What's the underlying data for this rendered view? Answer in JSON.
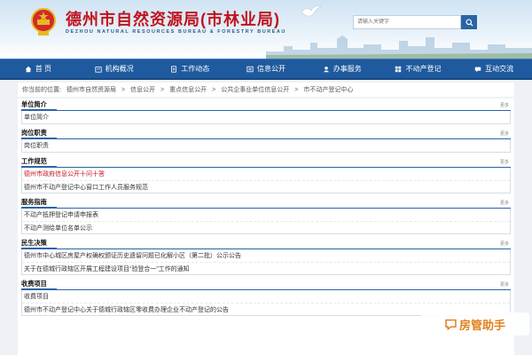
{
  "header": {
    "title": "德州市自然资源局(市林业局)",
    "subtitle": "DEZHOU NATURAL RESOURCES BUREAU & FORESTRY BUREAU",
    "search_placeholder": "请输入关键字"
  },
  "nav": [
    {
      "label": "首 页",
      "icon": "home-icon"
    },
    {
      "label": "机构概况",
      "icon": "building-icon"
    },
    {
      "label": "工作动态",
      "icon": "document-icon"
    },
    {
      "label": "信息公开",
      "icon": "info-icon"
    },
    {
      "label": "办事服务",
      "icon": "service-icon"
    },
    {
      "label": "不动产登记",
      "icon": "grid-icon"
    },
    {
      "label": "互动交流",
      "icon": "chat-icon"
    }
  ],
  "breadcrumb": {
    "prefix": "你当前的位置:",
    "items": [
      "德州市自然资源局",
      "信息公开",
      "重点信息公开",
      "公共企事业单位信息公开",
      "市不动产登记中心"
    ]
  },
  "more_label": "更多",
  "sections": [
    {
      "title": "单位简介",
      "rows": [
        "单位简介"
      ]
    },
    {
      "title": "岗位职责",
      "rows": [
        "岗位职责"
      ]
    },
    {
      "title": "工作规范",
      "rows": [
        "德州市政府信息公开十问十答",
        "德州市不动产登记中心窗口工作人员服务规范"
      ]
    },
    {
      "title": "服务指南",
      "rows": [
        "不动产抵押登记申请申报表",
        "不动产测绘单位名单公示"
      ]
    },
    {
      "title": "民生决策",
      "rows": [
        "德州市中心城区房屋产权确权颁证历史遗留问题已化解小区（第二批）公示公告",
        "关于在德城行政辖区开展工程建设项目“验登合一”工作的通知"
      ]
    },
    {
      "title": "收费项目",
      "rows": [
        "收费项目",
        "德州市不动产登记中心关于德城行政辖区零收费办理企业不动产登记的公告"
      ]
    }
  ],
  "watermark": "房管助手",
  "colors": {
    "brand_red": "#c1121f",
    "nav_blue": "#1f5a9e",
    "accent_blue": "#2a64a6",
    "watermark_orange": "#e0821f"
  }
}
